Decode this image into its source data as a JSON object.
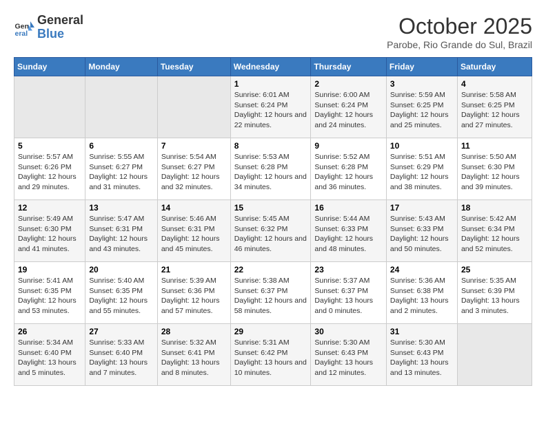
{
  "header": {
    "logo_line1": "General",
    "logo_line2": "Blue",
    "month": "October 2025",
    "location": "Parobe, Rio Grande do Sul, Brazil"
  },
  "days_of_week": [
    "Sunday",
    "Monday",
    "Tuesday",
    "Wednesday",
    "Thursday",
    "Friday",
    "Saturday"
  ],
  "weeks": [
    [
      {
        "day": "",
        "empty": true
      },
      {
        "day": "",
        "empty": true
      },
      {
        "day": "",
        "empty": true
      },
      {
        "day": "1",
        "sunrise": "6:01 AM",
        "sunset": "6:24 PM",
        "daylight": "12 hours and 22 minutes."
      },
      {
        "day": "2",
        "sunrise": "6:00 AM",
        "sunset": "6:24 PM",
        "daylight": "12 hours and 24 minutes."
      },
      {
        "day": "3",
        "sunrise": "5:59 AM",
        "sunset": "6:25 PM",
        "daylight": "12 hours and 25 minutes."
      },
      {
        "day": "4",
        "sunrise": "5:58 AM",
        "sunset": "6:25 PM",
        "daylight": "12 hours and 27 minutes."
      }
    ],
    [
      {
        "day": "5",
        "sunrise": "5:57 AM",
        "sunset": "6:26 PM",
        "daylight": "12 hours and 29 minutes."
      },
      {
        "day": "6",
        "sunrise": "5:55 AM",
        "sunset": "6:27 PM",
        "daylight": "12 hours and 31 minutes."
      },
      {
        "day": "7",
        "sunrise": "5:54 AM",
        "sunset": "6:27 PM",
        "daylight": "12 hours and 32 minutes."
      },
      {
        "day": "8",
        "sunrise": "5:53 AM",
        "sunset": "6:28 PM",
        "daylight": "12 hours and 34 minutes."
      },
      {
        "day": "9",
        "sunrise": "5:52 AM",
        "sunset": "6:28 PM",
        "daylight": "12 hours and 36 minutes."
      },
      {
        "day": "10",
        "sunrise": "5:51 AM",
        "sunset": "6:29 PM",
        "daylight": "12 hours and 38 minutes."
      },
      {
        "day": "11",
        "sunrise": "5:50 AM",
        "sunset": "6:30 PM",
        "daylight": "12 hours and 39 minutes."
      }
    ],
    [
      {
        "day": "12",
        "sunrise": "5:49 AM",
        "sunset": "6:30 PM",
        "daylight": "12 hours and 41 minutes."
      },
      {
        "day": "13",
        "sunrise": "5:47 AM",
        "sunset": "6:31 PM",
        "daylight": "12 hours and 43 minutes."
      },
      {
        "day": "14",
        "sunrise": "5:46 AM",
        "sunset": "6:31 PM",
        "daylight": "12 hours and 45 minutes."
      },
      {
        "day": "15",
        "sunrise": "5:45 AM",
        "sunset": "6:32 PM",
        "daylight": "12 hours and 46 minutes."
      },
      {
        "day": "16",
        "sunrise": "5:44 AM",
        "sunset": "6:33 PM",
        "daylight": "12 hours and 48 minutes."
      },
      {
        "day": "17",
        "sunrise": "5:43 AM",
        "sunset": "6:33 PM",
        "daylight": "12 hours and 50 minutes."
      },
      {
        "day": "18",
        "sunrise": "5:42 AM",
        "sunset": "6:34 PM",
        "daylight": "12 hours and 52 minutes."
      }
    ],
    [
      {
        "day": "19",
        "sunrise": "5:41 AM",
        "sunset": "6:35 PM",
        "daylight": "12 hours and 53 minutes."
      },
      {
        "day": "20",
        "sunrise": "5:40 AM",
        "sunset": "6:35 PM",
        "daylight": "12 hours and 55 minutes."
      },
      {
        "day": "21",
        "sunrise": "5:39 AM",
        "sunset": "6:36 PM",
        "daylight": "12 hours and 57 minutes."
      },
      {
        "day": "22",
        "sunrise": "5:38 AM",
        "sunset": "6:37 PM",
        "daylight": "12 hours and 58 minutes."
      },
      {
        "day": "23",
        "sunrise": "5:37 AM",
        "sunset": "6:37 PM",
        "daylight": "13 hours and 0 minutes."
      },
      {
        "day": "24",
        "sunrise": "5:36 AM",
        "sunset": "6:38 PM",
        "daylight": "13 hours and 2 minutes."
      },
      {
        "day": "25",
        "sunrise": "5:35 AM",
        "sunset": "6:39 PM",
        "daylight": "13 hours and 3 minutes."
      }
    ],
    [
      {
        "day": "26",
        "sunrise": "5:34 AM",
        "sunset": "6:40 PM",
        "daylight": "13 hours and 5 minutes."
      },
      {
        "day": "27",
        "sunrise": "5:33 AM",
        "sunset": "6:40 PM",
        "daylight": "13 hours and 7 minutes."
      },
      {
        "day": "28",
        "sunrise": "5:32 AM",
        "sunset": "6:41 PM",
        "daylight": "13 hours and 8 minutes."
      },
      {
        "day": "29",
        "sunrise": "5:31 AM",
        "sunset": "6:42 PM",
        "daylight": "13 hours and 10 minutes."
      },
      {
        "day": "30",
        "sunrise": "5:30 AM",
        "sunset": "6:43 PM",
        "daylight": "13 hours and 12 minutes."
      },
      {
        "day": "31",
        "sunrise": "5:30 AM",
        "sunset": "6:43 PM",
        "daylight": "13 hours and 13 minutes."
      },
      {
        "day": "",
        "empty": true
      }
    ]
  ]
}
